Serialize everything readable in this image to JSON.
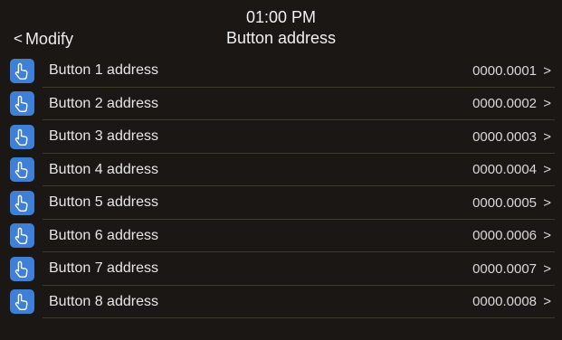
{
  "header": {
    "back_chevron": "<",
    "back_label": "Modify",
    "time": "01:00 PM",
    "title": "Button address"
  },
  "colors": {
    "background": "#1b1714",
    "icon_background": "#3f7fd6",
    "divider": "#3d3a2a"
  },
  "rows": [
    {
      "icon": "hand-pointer-icon",
      "label": "Button 1 address",
      "value": "0000.0001",
      "chevron": ">"
    },
    {
      "icon": "hand-pointer-icon",
      "label": "Button 2 address",
      "value": "0000.0002",
      "chevron": ">"
    },
    {
      "icon": "hand-pointer-icon",
      "label": "Button 3 address",
      "value": "0000.0003",
      "chevron": ">"
    },
    {
      "icon": "hand-pointer-icon",
      "label": "Button 4 address",
      "value": "0000.0004",
      "chevron": ">"
    },
    {
      "icon": "hand-pointer-icon",
      "label": "Button 5 address",
      "value": "0000.0005",
      "chevron": ">"
    },
    {
      "icon": "hand-pointer-icon",
      "label": "Button 6 address",
      "value": "0000.0006",
      "chevron": ">"
    },
    {
      "icon": "hand-pointer-icon",
      "label": "Button 7 address",
      "value": "0000.0007",
      "chevron": ">"
    },
    {
      "icon": "hand-pointer-icon",
      "label": "Button 8 address",
      "value": "0000.0008",
      "chevron": ">"
    }
  ]
}
